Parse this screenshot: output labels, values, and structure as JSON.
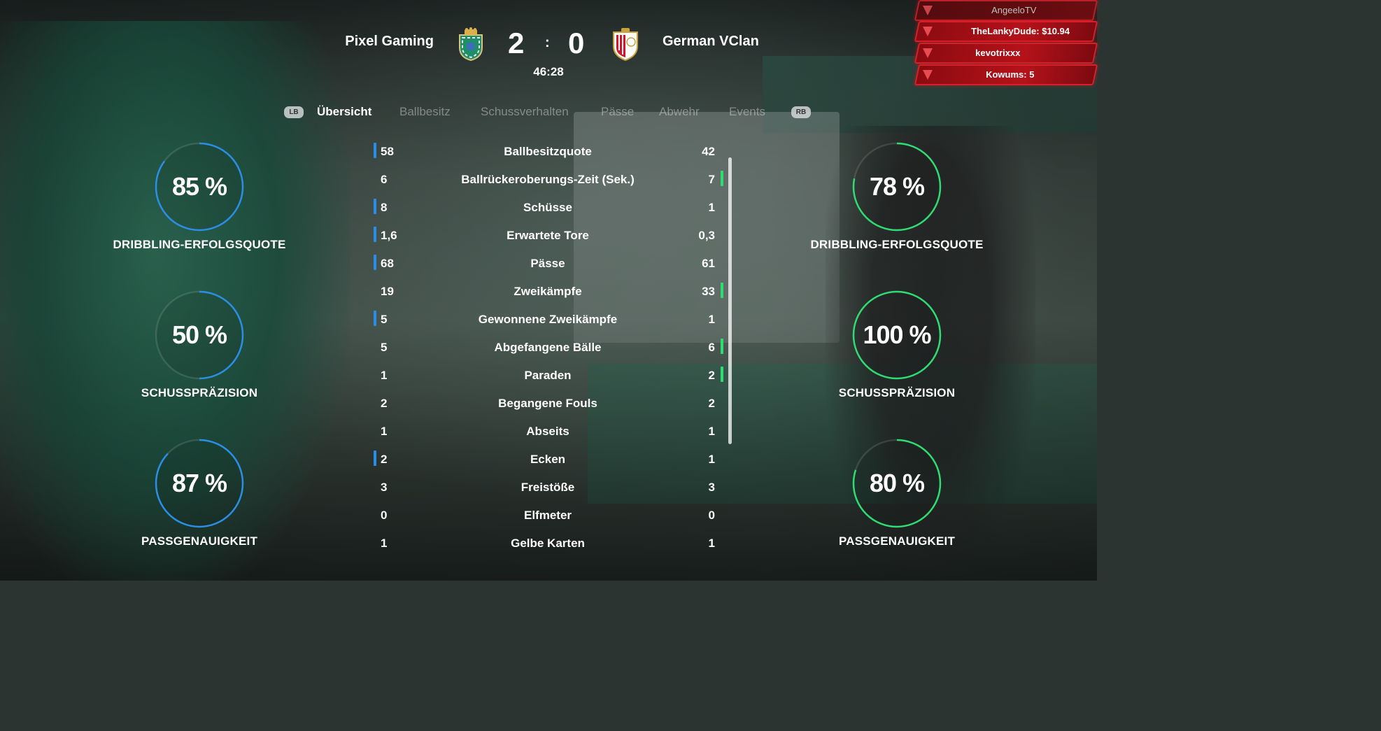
{
  "match": {
    "home_team": "Pixel Gaming",
    "away_team": "German VClan",
    "home_score": "2",
    "away_score": "0",
    "separator": ":",
    "clock": "46:28"
  },
  "tabs": {
    "lb_button": "LB",
    "rb_button": "RB",
    "items": [
      {
        "label": "Übersicht",
        "active": true
      },
      {
        "label": "Ballbesitz",
        "active": false
      },
      {
        "label": "Schussverhalten",
        "active": false
      },
      {
        "label": "Pässe",
        "active": false
      },
      {
        "label": "Abwehr",
        "active": false
      },
      {
        "label": "Events",
        "active": false
      }
    ]
  },
  "stream_alerts": [
    {
      "text": "AngeeloTV"
    },
    {
      "text": "TheLankyDude: $10.94"
    },
    {
      "text": "kevotrixxx"
    },
    {
      "text": "Kowums: 5"
    }
  ],
  "gauges": {
    "home": [
      {
        "value": "85 %",
        "fraction": 0.85,
        "label": "DRIBBLING-ERFOLGSQUOTE"
      },
      {
        "value": "50 %",
        "fraction": 0.5,
        "label": "SCHUSSPRÄZISION"
      },
      {
        "value": "87 %",
        "fraction": 0.87,
        "label": "PASSGENAUIGKEIT"
      }
    ],
    "away": [
      {
        "value": "78 %",
        "fraction": 0.78,
        "label": "DRIBBLING-ERFOLGSQUOTE"
      },
      {
        "value": "100 %",
        "fraction": 1.0,
        "label": "SCHUSSPRÄZISION"
      },
      {
        "value": "80 %",
        "fraction": 0.8,
        "label": "PASSGENAUIGKEIT"
      }
    ]
  },
  "colors": {
    "home_accent": "#2b8ee6",
    "away_accent": "#2fdc73",
    "alert_red": "#d8202a"
  },
  "stats": [
    {
      "label": "Ballbesitzquote",
      "home": "58",
      "away": "42",
      "leader": "home"
    },
    {
      "label": "Ballrückeroberungs-Zeit (Sek.)",
      "home": "6",
      "away": "7",
      "leader": "away"
    },
    {
      "label": "Schüsse",
      "home": "8",
      "away": "1",
      "leader": "home"
    },
    {
      "label": "Erwartete Tore",
      "home": "1,6",
      "away": "0,3",
      "leader": "home"
    },
    {
      "label": "Pässe",
      "home": "68",
      "away": "61",
      "leader": "home"
    },
    {
      "label": "Zweikämpfe",
      "home": "19",
      "away": "33",
      "leader": "away"
    },
    {
      "label": "Gewonnene Zweikämpfe",
      "home": "5",
      "away": "1",
      "leader": "home"
    },
    {
      "label": "Abgefangene Bälle",
      "home": "5",
      "away": "6",
      "leader": "away"
    },
    {
      "label": "Paraden",
      "home": "1",
      "away": "2",
      "leader": "away"
    },
    {
      "label": "Begangene Fouls",
      "home": "2",
      "away": "2",
      "leader": "none"
    },
    {
      "label": "Abseits",
      "home": "1",
      "away": "1",
      "leader": "none"
    },
    {
      "label": "Ecken",
      "home": "2",
      "away": "1",
      "leader": "home"
    },
    {
      "label": "Freistöße",
      "home": "3",
      "away": "3",
      "leader": "none"
    },
    {
      "label": "Elfmeter",
      "home": "0",
      "away": "0",
      "leader": "none"
    },
    {
      "label": "Gelbe Karten",
      "home": "1",
      "away": "1",
      "leader": "none"
    }
  ]
}
